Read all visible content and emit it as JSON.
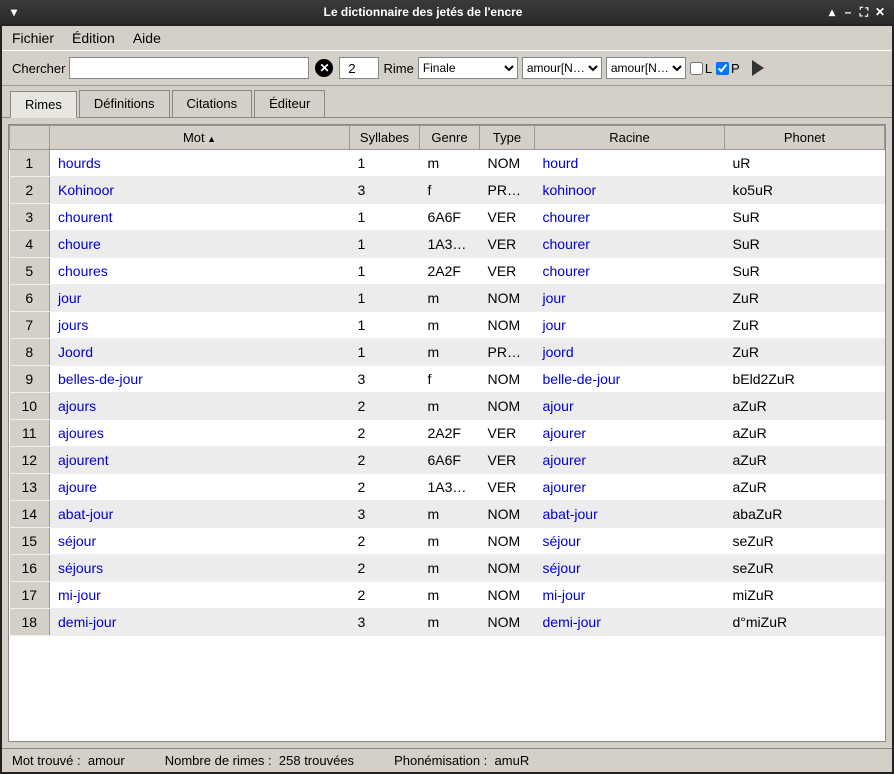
{
  "titlebar": {
    "title": "Le dictionnaire des jetés de l'encre"
  },
  "menu": {
    "file": "Fichier",
    "edit": "Édition",
    "help": "Aide"
  },
  "toolbar": {
    "search_label": "Chercher",
    "search_value": "",
    "count_value": "2",
    "rime_label": "Rime",
    "rime_select": "Finale",
    "sel1": "amour[N…",
    "sel2": "amour[N…",
    "cb_l": "L",
    "cb_p": "P"
  },
  "tabs": {
    "t1": "Rimes",
    "t2": "Définitions",
    "t3": "Citations",
    "t4": "Éditeur"
  },
  "columns": {
    "c1": "Mot",
    "c2": "Syllabes",
    "c3": "Genre",
    "c4": "Type",
    "c5": "Racine",
    "c6": "Phonet"
  },
  "rows": [
    {
      "n": "1",
      "mot": "hourds",
      "syl": "1",
      "genre": "m",
      "type": "NOM",
      "racine": "hourd",
      "phon": "uR"
    },
    {
      "n": "2",
      "mot": "Kohinoor",
      "syl": "3",
      "genre": "f",
      "type": "PR…",
      "racine": "kohinoor",
      "phon": "ko5uR"
    },
    {
      "n": "3",
      "mot": "chourent",
      "syl": "1",
      "genre": "6A6F",
      "type": "VER",
      "racine": "chourer",
      "phon": "SuR"
    },
    {
      "n": "4",
      "mot": "choure",
      "syl": "1",
      "genre": "1A3…",
      "type": "VER",
      "racine": "chourer",
      "phon": "SuR"
    },
    {
      "n": "5",
      "mot": "choures",
      "syl": "1",
      "genre": "2A2F",
      "type": "VER",
      "racine": "chourer",
      "phon": "SuR"
    },
    {
      "n": "6",
      "mot": "jour",
      "syl": "1",
      "genre": "m",
      "type": "NOM",
      "racine": "jour",
      "phon": "ZuR"
    },
    {
      "n": "7",
      "mot": "jours",
      "syl": "1",
      "genre": "m",
      "type": "NOM",
      "racine": "jour",
      "phon": "ZuR"
    },
    {
      "n": "8",
      "mot": "Joord",
      "syl": "1",
      "genre": "m",
      "type": "PR…",
      "racine": "joord",
      "phon": "ZuR"
    },
    {
      "n": "9",
      "mot": "belles-de-jour",
      "syl": "3",
      "genre": "f",
      "type": "NOM",
      "racine": "belle-de-jour",
      "phon": "bEld2ZuR"
    },
    {
      "n": "10",
      "mot": "ajours",
      "syl": "2",
      "genre": "m",
      "type": "NOM",
      "racine": "ajour",
      "phon": "aZuR"
    },
    {
      "n": "11",
      "mot": "ajoures",
      "syl": "2",
      "genre": "2A2F",
      "type": "VER",
      "racine": "ajourer",
      "phon": "aZuR"
    },
    {
      "n": "12",
      "mot": "ajourent",
      "syl": "2",
      "genre": "6A6F",
      "type": "VER",
      "racine": "ajourer",
      "phon": "aZuR"
    },
    {
      "n": "13",
      "mot": "ajoure",
      "syl": "2",
      "genre": "1A3…",
      "type": "VER",
      "racine": "ajourer",
      "phon": "aZuR"
    },
    {
      "n": "14",
      "mot": "abat-jour",
      "syl": "3",
      "genre": "m",
      "type": "NOM",
      "racine": "abat-jour",
      "phon": "abaZuR"
    },
    {
      "n": "15",
      "mot": "séjour",
      "syl": "2",
      "genre": "m",
      "type": "NOM",
      "racine": "séjour",
      "phon": "seZuR"
    },
    {
      "n": "16",
      "mot": "séjours",
      "syl": "2",
      "genre": "m",
      "type": "NOM",
      "racine": "séjour",
      "phon": "seZuR"
    },
    {
      "n": "17",
      "mot": "mi-jour",
      "syl": "2",
      "genre": "m",
      "type": "NOM",
      "racine": "mi-jour",
      "phon": "miZuR"
    },
    {
      "n": "18",
      "mot": "demi-jour",
      "syl": "3",
      "genre": "m",
      "type": "NOM",
      "racine": "demi-jour",
      "phon": "d°miZuR"
    }
  ],
  "status": {
    "s1_label": "Mot trouvé :",
    "s1_val": "amour",
    "s2_label": "Nombre de rimes :",
    "s2_val": "258 trouvées",
    "s3_label": "Phonémisation :",
    "s3_val": "amuR"
  }
}
